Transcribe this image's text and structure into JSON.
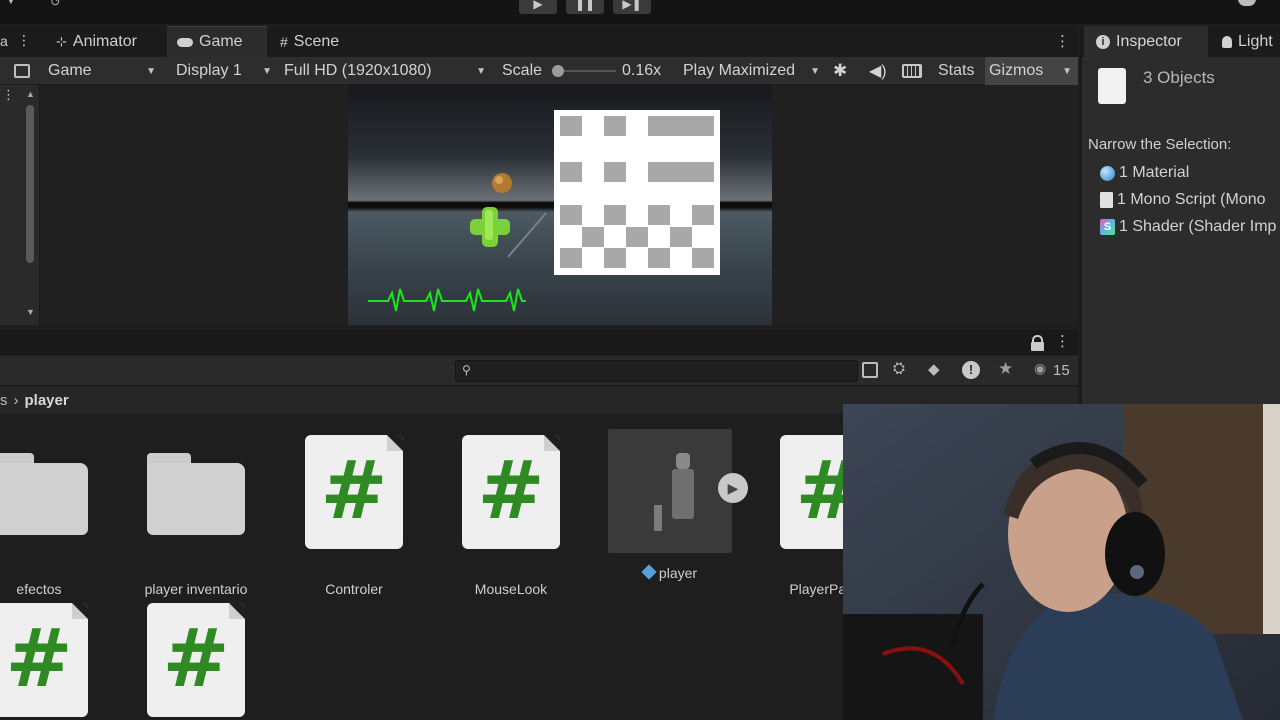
{
  "tabs": [
    {
      "label": "Animator",
      "icon": "animator-icon"
    },
    {
      "label": "Game",
      "icon": "gamepad-icon"
    },
    {
      "label": "Scene",
      "icon": "grid-icon"
    }
  ],
  "game_toolbar": {
    "view": "Game",
    "display": "Display 1",
    "resolution": "Full HD (1920x1080)",
    "scale_label": "Scale",
    "scale_value": "0.16x",
    "play_mode": "Play Maximized",
    "stats": "Stats",
    "gizmos": "Gizmos"
  },
  "inspector": {
    "tabs": [
      {
        "label": "Inspector",
        "icon": "info-icon"
      },
      {
        "label": "Light",
        "icon": "bulb-icon"
      }
    ],
    "title": "3 Objects",
    "narrow": "Narrow the Selection:",
    "items": [
      {
        "label": "1 Material",
        "icon": "material-sphere-icon"
      },
      {
        "label": "1 Mono Script (Mono",
        "icon": "script-file-icon"
      },
      {
        "label": "1 Shader (Shader Imp",
        "icon": "shader-icon"
      }
    ]
  },
  "project": {
    "breadcrumb_prefix": "s",
    "breadcrumb_current": "player",
    "visible_count": "15",
    "assets": [
      {
        "label": "efectos",
        "type": "folder"
      },
      {
        "label": "player inventario",
        "type": "folder"
      },
      {
        "label": "Controler",
        "type": "script"
      },
      {
        "label": "MouseLook",
        "type": "script"
      },
      {
        "label": "player",
        "type": "prefab"
      },
      {
        "label": "PlayerPathG",
        "type": "script"
      },
      {
        "label": "",
        "type": "script"
      },
      {
        "label": "",
        "type": "script"
      }
    ]
  },
  "colors": {
    "accent_green": "#2f8a23",
    "heartbeat": "#19e619",
    "panel": "#2c2c2c",
    "background": "#1e1e1e"
  }
}
